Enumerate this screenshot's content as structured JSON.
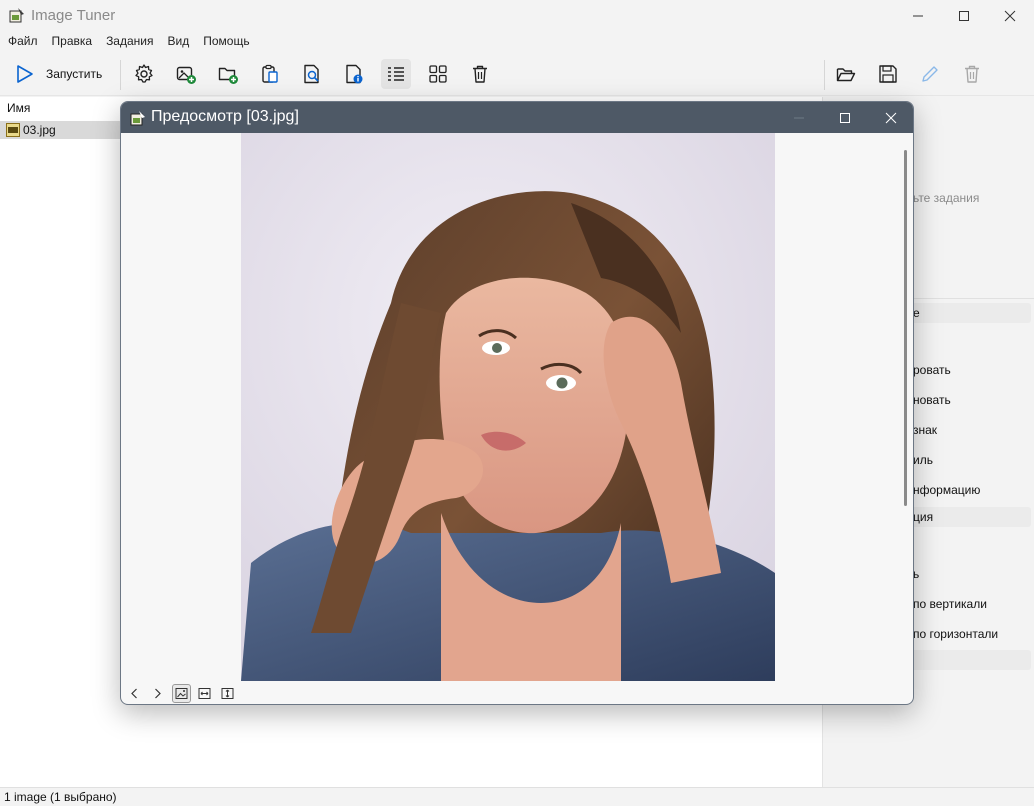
{
  "window": {
    "title": "Image Tuner",
    "controls": [
      "minimize",
      "maximize",
      "close"
    ]
  },
  "menu": [
    "Файл",
    "Правка",
    "Задания",
    "Вид",
    "Помощь"
  ],
  "toolbar": {
    "run_label": "Запустить",
    "icons": [
      "play-icon",
      "gear-icon",
      "add-image-icon",
      "add-folder-icon",
      "paste-icon",
      "preview-icon",
      "image-info-icon",
      "list-view-icon",
      "grid-view-icon",
      "trash-icon",
      "open-folder-icon",
      "save-icon",
      "pencil-icon",
      "trash-disabled-icon"
    ]
  },
  "filelist": {
    "column_header": "Имя",
    "rows": [
      {
        "name": "03.jpg",
        "selected": true
      }
    ]
  },
  "right_panel": {
    "hint": "ьте задания",
    "lines": [
      "е",
      "ровать",
      "новать",
      "знак",
      "иль",
      "нформацию",
      "ция",
      "ь",
      "по вертикали",
      "по горизонтали"
    ]
  },
  "status": "1 image (1 выбрано)",
  "preview": {
    "title": "Предосмотр [03.jpg]",
    "nav_icons": [
      "chevron-left-icon",
      "chevron-right-icon",
      "fit-image-icon",
      "fit-width-icon",
      "fit-height-icon"
    ]
  },
  "colors": {
    "accent": "#0a64d0",
    "preview_titlebar": "#4e5966",
    "selection": "#d9d9d9"
  }
}
